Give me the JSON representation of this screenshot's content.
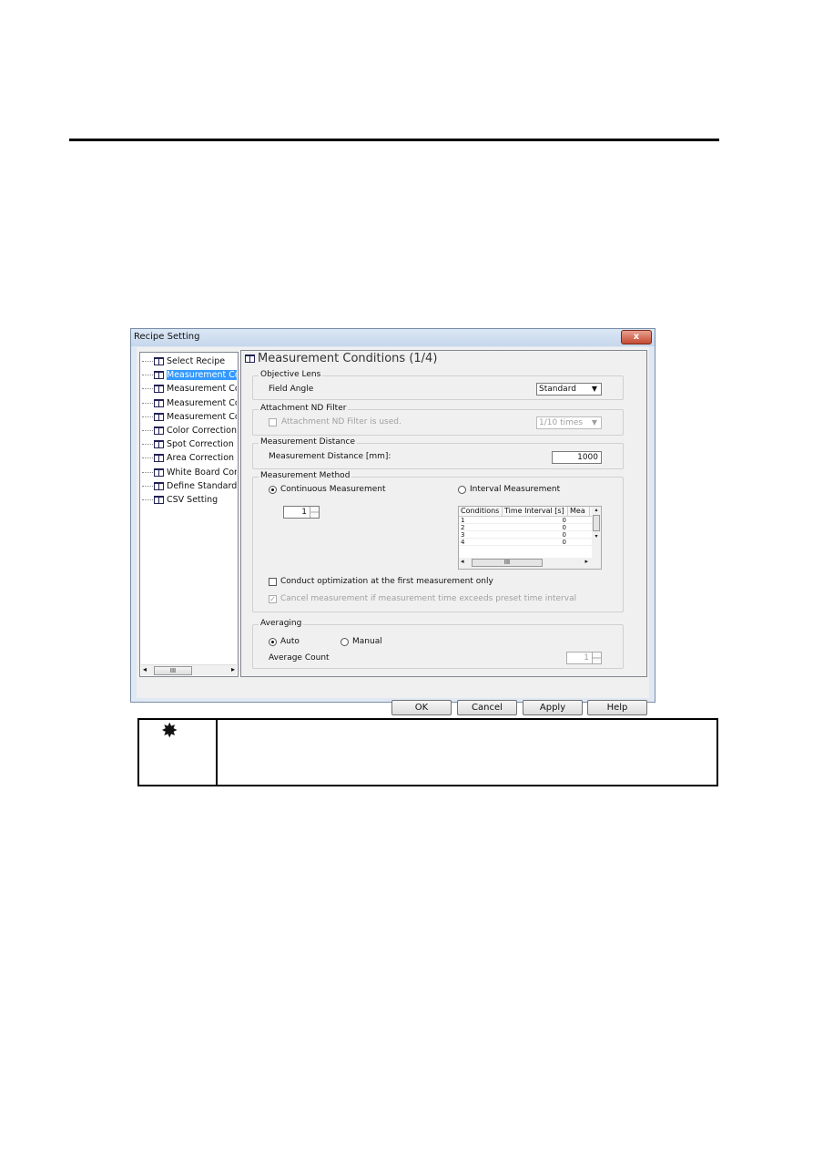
{
  "dialog": {
    "title": "Recipe Setting",
    "close_label": "x",
    "tree": [
      {
        "label": "Select Recipe",
        "selected": false
      },
      {
        "label": "Measurement Co",
        "selected": true
      },
      {
        "label": "Measurement Co",
        "selected": false
      },
      {
        "label": "Measurement Co",
        "selected": false
      },
      {
        "label": "Measurement Co",
        "selected": false
      },
      {
        "label": "Color Correction",
        "selected": false
      },
      {
        "label": "Spot Correction",
        "selected": false
      },
      {
        "label": "Area Correction",
        "selected": false
      },
      {
        "label": "White Board Corr",
        "selected": false
      },
      {
        "label": "Define Standard '",
        "selected": false
      },
      {
        "label": "CSV Setting",
        "selected": false
      }
    ],
    "tree_scroll_thumb": "III",
    "panel_title": "Measurement Conditions (1/4)",
    "objective_lens": {
      "group": "Objective Lens",
      "field_label": "Field Angle",
      "value": "Standard"
    },
    "nd_filter": {
      "group": "Attachment ND Filter",
      "checkbox_label": "Attachment ND Filter is used.",
      "checked": false,
      "value": "1/10 times"
    },
    "distance": {
      "group": "Measurement Distance",
      "label": "Measurement Distance [mm]:",
      "value": "1000"
    },
    "method": {
      "group": "Measurement Method",
      "continuous_label": "Continuous Measurement",
      "interval_label": "Interval Measurement",
      "selected": "continuous",
      "count": "1",
      "grid_headers": [
        "Conditions",
        "Time Interval [s]",
        "Mea"
      ],
      "grid_rows": [
        [
          "1",
          "0"
        ],
        [
          "2",
          "0"
        ],
        [
          "3",
          "0"
        ],
        [
          "4",
          "0"
        ]
      ],
      "grid_scroll_thumb": "III",
      "optimization_label": "Conduct optimization at the first measurement only",
      "optimization_checked": false,
      "cancel_label": "Cancel measurement if measurement time exceeds preset time interval",
      "cancel_checked": true
    },
    "averaging": {
      "group": "Averaging",
      "auto_label": "Auto",
      "manual_label": "Manual",
      "selected": "auto",
      "count_label": "Average Count",
      "count": "1"
    },
    "buttons": {
      "ok": "OK",
      "cancel": "Cancel",
      "apply": "Apply",
      "help": "Help"
    }
  },
  "note": {
    "icon": "starburst-icon",
    "text": ""
  }
}
